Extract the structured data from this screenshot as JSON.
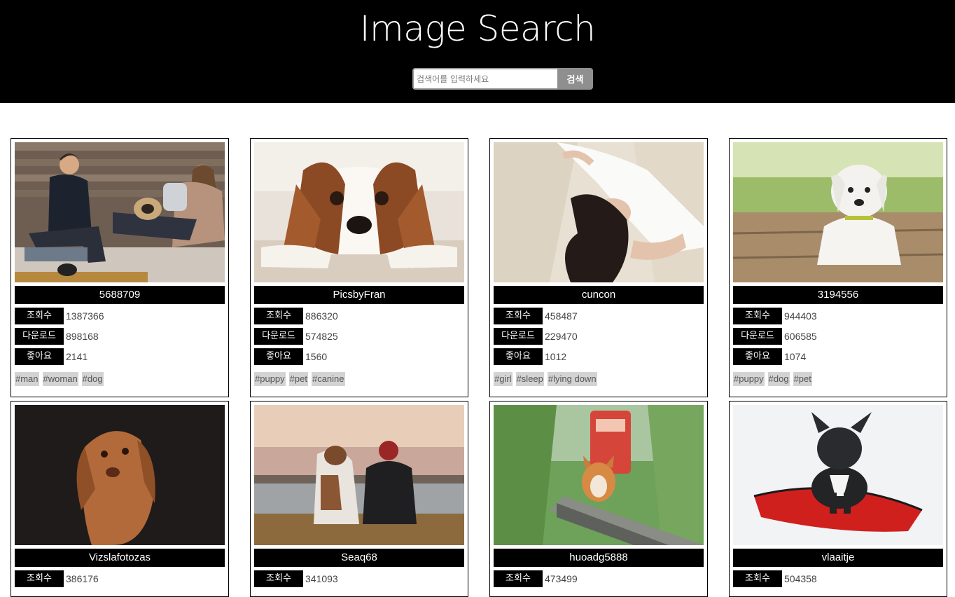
{
  "header": {
    "title": "Image Search",
    "search": {
      "placeholder": "검색어를 입력하세요",
      "value": "",
      "button_label": "검색"
    }
  },
  "labels": {
    "views": "조회수",
    "downloads": "다운로드",
    "likes": "좋아요"
  },
  "cards": [
    {
      "user": "5688709",
      "views": "1387366",
      "downloads": "898168",
      "likes": "2141",
      "tags": [
        "#man",
        "#woman",
        "#dog"
      ]
    },
    {
      "user": "PicsbyFran",
      "views": "886320",
      "downloads": "574825",
      "likes": "1560",
      "tags": [
        "#puppy",
        "#pet",
        "#canine"
      ]
    },
    {
      "user": "cuncon",
      "views": "458487",
      "downloads": "229470",
      "likes": "1012",
      "tags": [
        "#girl",
        "#sleep",
        "#lying down"
      ]
    },
    {
      "user": "3194556",
      "views": "944403",
      "downloads": "606585",
      "likes": "1074",
      "tags": [
        "#puppy",
        "#dog",
        "#pet"
      ]
    },
    {
      "user": "Vizslafotozas",
      "views": "386176"
    },
    {
      "user": "Seaq68",
      "views": "341093"
    },
    {
      "user": "huoadg5888",
      "views": "473499"
    },
    {
      "user": "vlaaitje",
      "views": "504358"
    }
  ]
}
